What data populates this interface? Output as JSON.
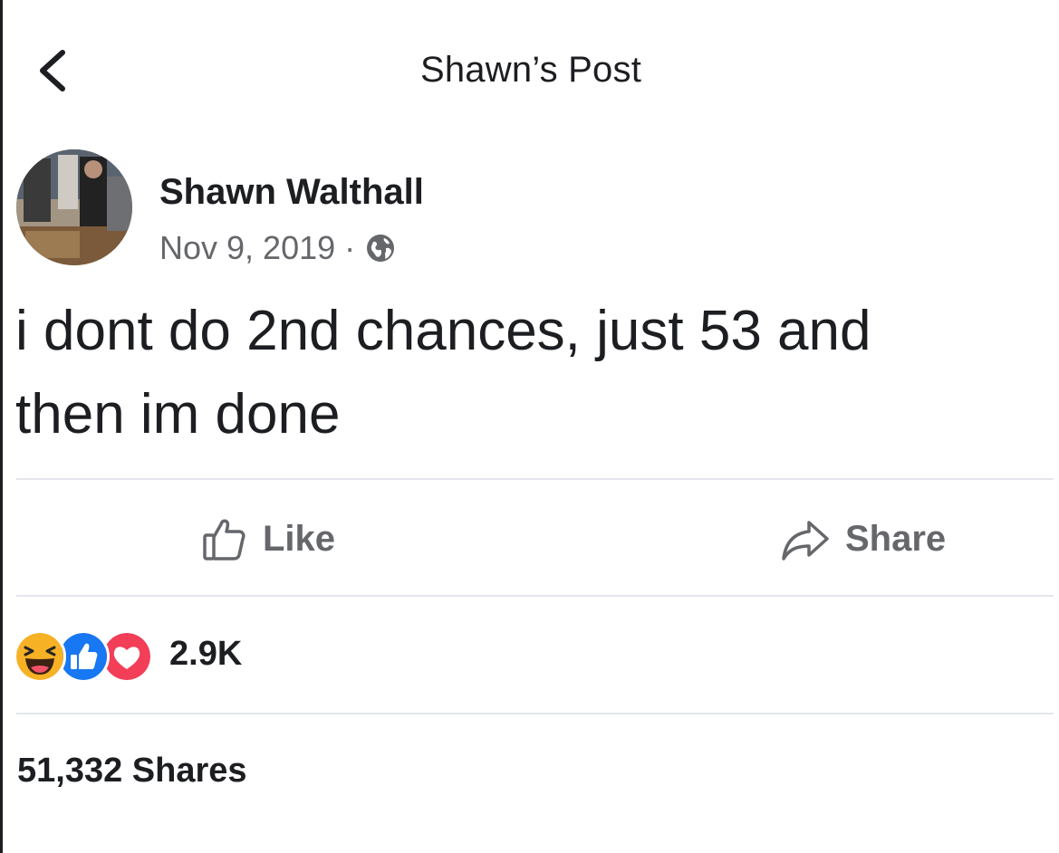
{
  "header": {
    "title": "Shawn’s Post",
    "back_icon": "chevron-left-icon"
  },
  "post": {
    "author": "Shawn Walthall",
    "date": "Nov 9, 2019",
    "separator": "·",
    "privacy_icon": "globe-icon",
    "text_line1": "i dont do 2nd chances, just 53 and",
    "text_line2": "then im done"
  },
  "actions": {
    "like_label": "Like",
    "share_label": "Share"
  },
  "reactions": {
    "icons": [
      "haha-reaction-icon",
      "like-reaction-icon",
      "love-reaction-icon"
    ],
    "count": "2.9K"
  },
  "shares": {
    "label": "51,332 Shares"
  },
  "colors": {
    "text": "#1c1e21",
    "secondary_text": "#65676b",
    "divider": "#e4e6eb",
    "like_blue": "#1877f2",
    "love_red": "#f33e58",
    "haha_yellow": "#f7b125"
  }
}
